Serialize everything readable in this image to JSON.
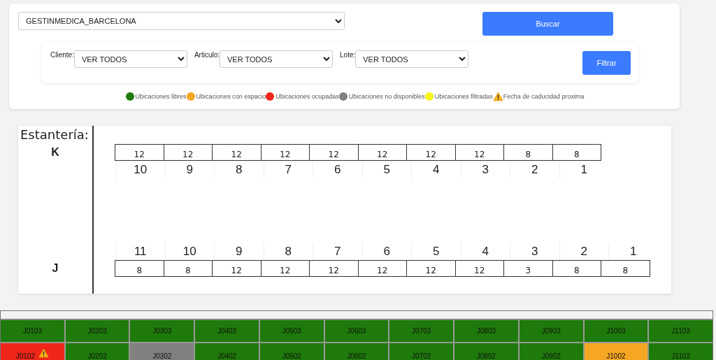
{
  "warehouse_select": {
    "value": "GESTINMEDICA_BARCELONA"
  },
  "search_button": "Buscar",
  "filters": [
    {
      "label": "Cliente:",
      "value": "VER TODOS"
    },
    {
      "label": "Articulo:",
      "value": "VER TODOS"
    },
    {
      "label": "Lote:",
      "value": "VER TODOS"
    }
  ],
  "filter_button": "Filtrar",
  "legend": [
    {
      "kind": "dot",
      "color": "#1e7a0a",
      "label": "Ubicaciones libres"
    },
    {
      "kind": "dot",
      "color": "#f5a623",
      "label": "Ubicaciones con espacio"
    },
    {
      "kind": "dot",
      "color": "#f0261a",
      "label": "Ubicaciones ocupadas"
    },
    {
      "kind": "dot",
      "color": "#808080",
      "label": "Ubicaciones no disponibles"
    },
    {
      "kind": "dot",
      "color": "#f5f51a",
      "label": "Ubicaciones filtradas"
    },
    {
      "kind": "warning",
      "label": "Fecha de caducidad proxima"
    }
  ],
  "shelf_title": "Estantería:",
  "shelves": [
    {
      "name": "K",
      "kind": "counts_first",
      "cells": [
        {
          "count": "12",
          "number": "10"
        },
        {
          "count": "12",
          "number": "9"
        },
        {
          "count": "12",
          "number": "8"
        },
        {
          "count": "12",
          "number": "7"
        },
        {
          "count": "12",
          "number": "6"
        },
        {
          "count": "12",
          "number": "5"
        },
        {
          "count": "12",
          "number": "4"
        },
        {
          "count": "12",
          "number": "3"
        },
        {
          "count": "8",
          "number": "2"
        },
        {
          "count": "8",
          "number": "1"
        }
      ]
    },
    {
      "name": "J",
      "kind": "numbers_first",
      "cells": [
        {
          "count": "8",
          "number": "11"
        },
        {
          "count": "8",
          "number": "10"
        },
        {
          "count": "12",
          "number": "9"
        },
        {
          "count": "12",
          "number": "8"
        },
        {
          "count": "12",
          "number": "7"
        },
        {
          "count": "12",
          "number": "6"
        },
        {
          "count": "12",
          "number": "5"
        },
        {
          "count": "12",
          "number": "4"
        },
        {
          "count": "3",
          "number": "3"
        },
        {
          "count": "8",
          "number": "2"
        },
        {
          "count": "8",
          "number": "1"
        }
      ]
    }
  ],
  "locations": [
    [
      {
        "code": "J0103",
        "color": "#1e7a0a",
        "warning": false
      },
      {
        "code": "J0203",
        "color": "#1e7a0a",
        "warning": false
      },
      {
        "code": "J0303",
        "color": "#1e7a0a",
        "warning": false
      },
      {
        "code": "J0403",
        "color": "#1e7a0a",
        "warning": false
      },
      {
        "code": "J0503",
        "color": "#1e7a0a",
        "warning": false
      },
      {
        "code": "J0603",
        "color": "#1e7a0a",
        "warning": false
      },
      {
        "code": "J0703",
        "color": "#1e7a0a",
        "warning": false
      },
      {
        "code": "J0803",
        "color": "#1e7a0a",
        "warning": false
      },
      {
        "code": "J0903",
        "color": "#1e7a0a",
        "warning": false
      },
      {
        "code": "J1003",
        "color": "#1e7a0a",
        "warning": false
      },
      {
        "code": "J1103",
        "color": "#1e7a0a",
        "warning": false
      }
    ],
    [
      {
        "code": "J0102",
        "color": "#f0261a",
        "warning": true
      },
      {
        "code": "J0202",
        "color": "#1e7a0a",
        "warning": false
      },
      {
        "code": "J0302",
        "color": "#808080",
        "warning": false
      },
      {
        "code": "J0402",
        "color": "#1e7a0a",
        "warning": false
      },
      {
        "code": "J0502",
        "color": "#1e7a0a",
        "warning": false
      },
      {
        "code": "J0602",
        "color": "#1e7a0a",
        "warning": false
      },
      {
        "code": "J0702",
        "color": "#1e7a0a",
        "warning": false
      },
      {
        "code": "J0802",
        "color": "#1e7a0a",
        "warning": false
      },
      {
        "code": "J0902",
        "color": "#1e7a0a",
        "warning": false
      },
      {
        "code": "J1002",
        "color": "#f5a623",
        "warning": false
      },
      {
        "code": "J1102",
        "color": "#1e7a0a",
        "warning": false
      }
    ]
  ]
}
